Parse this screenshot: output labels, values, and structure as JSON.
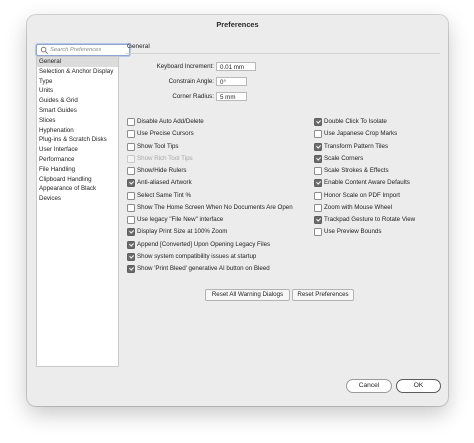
{
  "window": {
    "title": "Preferences"
  },
  "search": {
    "placeholder": "Search Preferences"
  },
  "sidebar": {
    "items": [
      {
        "label": "General",
        "selected": true
      },
      {
        "label": "Selection & Anchor Display"
      },
      {
        "label": "Type"
      },
      {
        "label": "Units"
      },
      {
        "label": "Guides & Grid"
      },
      {
        "label": "Smart Guides"
      },
      {
        "label": "Slices"
      },
      {
        "label": "Hyphenation"
      },
      {
        "label": "Plug-ins & Scratch Disks"
      },
      {
        "label": "User Interface"
      },
      {
        "label": "Performance"
      },
      {
        "label": "File Handling"
      },
      {
        "label": "Clipboard Handling"
      },
      {
        "label": "Appearance of Black"
      },
      {
        "label": "Devices"
      }
    ]
  },
  "panel": {
    "title": "General",
    "fields": [
      {
        "label": "Keyboard Increment:",
        "value": "0.01 mm"
      },
      {
        "label": "Constrain Angle:",
        "value": "0°"
      },
      {
        "label": "Corner Radius:",
        "value": "5 mm"
      }
    ],
    "left_options": [
      {
        "label": "Disable Auto Add/Delete",
        "checked": false
      },
      {
        "label": "Use Precise Cursors",
        "checked": false
      },
      {
        "label": "Show Tool Tips",
        "checked": false
      },
      {
        "label": "Show Rich Tool Tips",
        "checked": false,
        "disabled": true
      },
      {
        "label": "Show/Hide Rulers",
        "checked": false
      },
      {
        "label": "Anti-aliased Artwork",
        "checked": true
      },
      {
        "label": "Select Same Tint %",
        "checked": false
      },
      {
        "label": "Show The Home Screen When No Documents Are Open",
        "checked": false
      },
      {
        "label": "Use legacy \"File New\" interface",
        "checked": false
      },
      {
        "label": "Display Print Size at 100% Zoom",
        "checked": true
      },
      {
        "label": "Append [Converted] Upon Opening Legacy Files",
        "checked": true
      },
      {
        "label": "Show system compatibility issues at startup",
        "checked": true
      },
      {
        "label": "Show 'Print Bleed' generative AI button on Bleed",
        "checked": true
      }
    ],
    "right_options": [
      {
        "label": "Double Click To Isolate",
        "checked": true
      },
      {
        "label": "Use Japanese Crop Marks",
        "checked": false
      },
      {
        "label": "Transform Pattern Tiles",
        "checked": true
      },
      {
        "label": "Scale Corners",
        "checked": true
      },
      {
        "label": "Scale Strokes & Effects",
        "checked": false
      },
      {
        "label": "Enable Content Aware Defaults",
        "checked": true
      },
      {
        "label": "Honor Scale on PDF Import",
        "checked": false
      },
      {
        "label": "Zoom with Mouse Wheel",
        "checked": false
      },
      {
        "label": "Trackpad Gesture to Rotate View",
        "checked": true
      },
      {
        "label": "Use Preview Bounds",
        "checked": false
      }
    ],
    "reset_warnings_label": "Reset All Warning Dialogs",
    "reset_prefs_label": "Reset Preferences"
  },
  "footer": {
    "cancel_label": "Cancel",
    "ok_label": "OK"
  },
  "colors": {
    "checked_fill": "#6b6b6b",
    "dialog_bg": "#ececec",
    "search_focus": "#8ea7d2"
  }
}
